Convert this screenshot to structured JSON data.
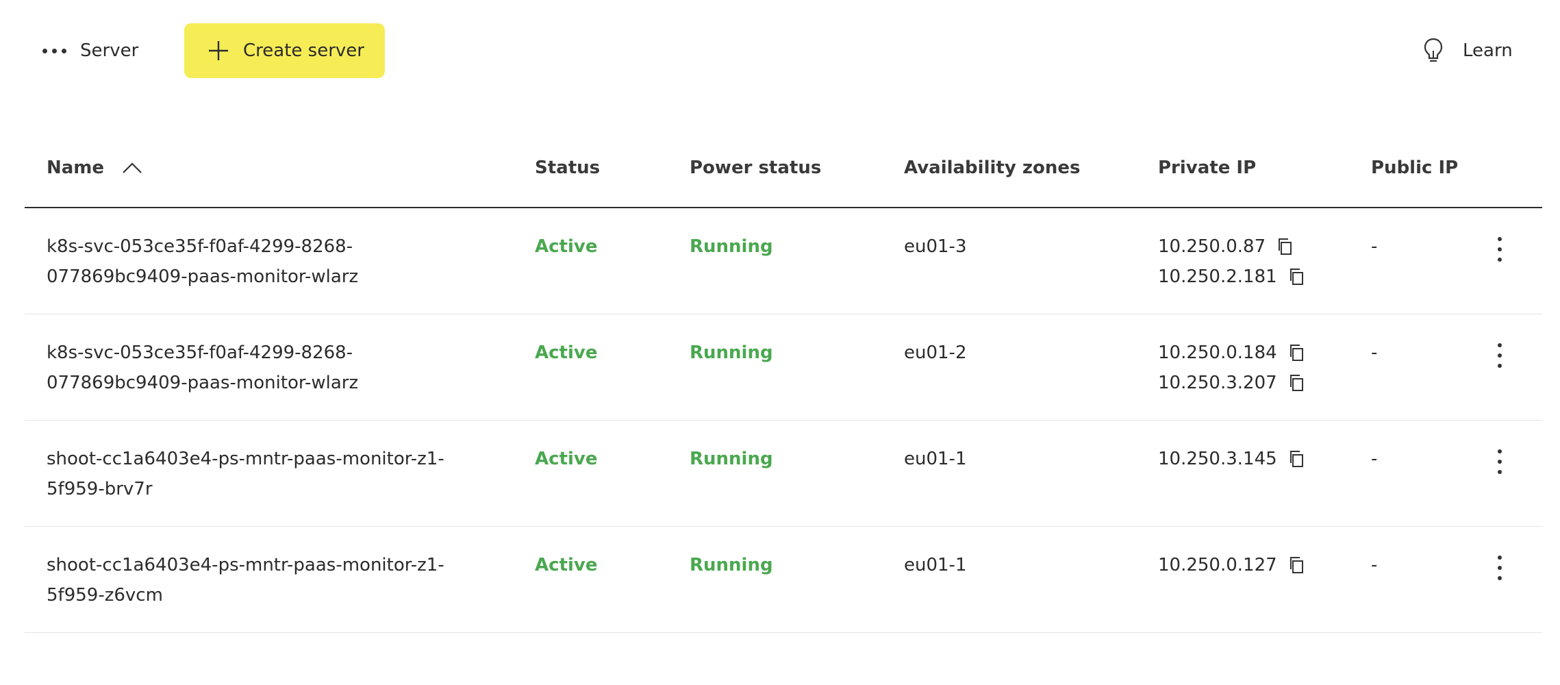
{
  "toolbar": {
    "more_label": "Server",
    "more_icon": "ellipsis-horizontal-icon",
    "create_label": "Create server",
    "create_icon": "plus-icon",
    "learn_label": "Learn",
    "learn_icon": "lightbulb-icon",
    "accent_color": "#f6ec56"
  },
  "table": {
    "sort_column": "Name",
    "sort_icon": "chevron-up-icon",
    "columns": [
      "Name",
      "Status",
      "Power status",
      "Availability zones",
      "Private IP",
      "Public IP"
    ],
    "status_color": "#4aa84f",
    "rows": [
      {
        "name": "k8s-svc-053ce35f-f0af-4299-8268-077869bc9409-paas-monitor-wlarz",
        "status": "Active",
        "power": "Running",
        "zone": "eu01-3",
        "private_ips": [
          "10.250.0.87",
          "10.250.2.181"
        ],
        "public_ip": "-"
      },
      {
        "name": "k8s-svc-053ce35f-f0af-4299-8268-077869bc9409-paas-monitor-wlarz",
        "status": "Active",
        "power": "Running",
        "zone": "eu01-2",
        "private_ips": [
          "10.250.0.184",
          "10.250.3.207"
        ],
        "public_ip": "-"
      },
      {
        "name": "shoot-cc1a6403e4-ps-mntr-paas-monitor-z1-5f959-brv7r",
        "status": "Active",
        "power": "Running",
        "zone": "eu01-1",
        "private_ips": [
          "10.250.3.145"
        ],
        "public_ip": "-"
      },
      {
        "name": "shoot-cc1a6403e4-ps-mntr-paas-monitor-z1-5f959-z6vcm",
        "status": "Active",
        "power": "Running",
        "zone": "eu01-1",
        "private_ips": [
          "10.250.0.127"
        ],
        "public_ip": "-"
      }
    ]
  }
}
